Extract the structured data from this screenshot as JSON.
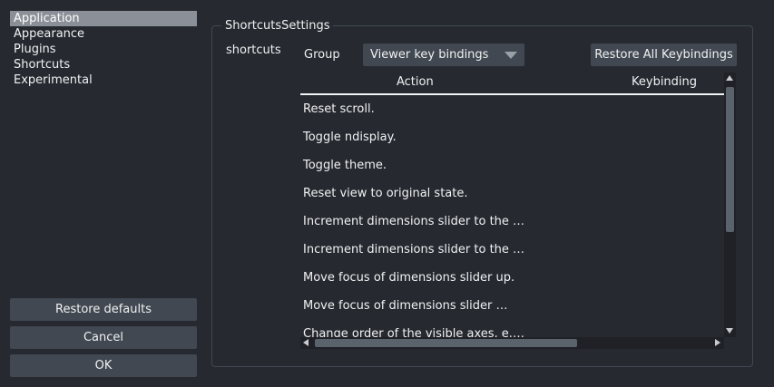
{
  "sidebar": {
    "items": [
      {
        "label": "Application"
      },
      {
        "label": "Appearance"
      },
      {
        "label": "Plugins"
      },
      {
        "label": "Shortcuts"
      },
      {
        "label": "Experimental"
      }
    ],
    "selected": "Application"
  },
  "buttons": {
    "restore_defaults": "Restore defaults",
    "cancel": "Cancel",
    "ok": "OK"
  },
  "panel": {
    "title": "ShortcutsSettings",
    "form_label": "shortcuts",
    "group_label": "Group",
    "group_value": "Viewer key bindings",
    "restore_all": "Restore All Keybindings"
  },
  "table": {
    "columns": [
      "Action",
      "Keybinding"
    ],
    "rows": [
      {
        "action": "Reset scroll.",
        "key": ""
      },
      {
        "action": "Toggle ndisplay.",
        "key": ""
      },
      {
        "action": "Toggle theme.",
        "key": ""
      },
      {
        "action": "Reset view to original state.",
        "key": ""
      },
      {
        "action": "Increment dimensions slider to the …",
        "key": ""
      },
      {
        "action": "Increment dimensions slider to the …",
        "key": ""
      },
      {
        "action": "Move focus of dimensions slider up.",
        "key": ""
      },
      {
        "action": "Move focus of dimensions slider …",
        "key": ""
      },
      {
        "action": "Change order of the visible axes, e.…",
        "key": ""
      }
    ]
  },
  "colors": {
    "background": "#262930",
    "button": "#414851",
    "selected": "#8b8f97",
    "text": "#f0f1f2"
  }
}
